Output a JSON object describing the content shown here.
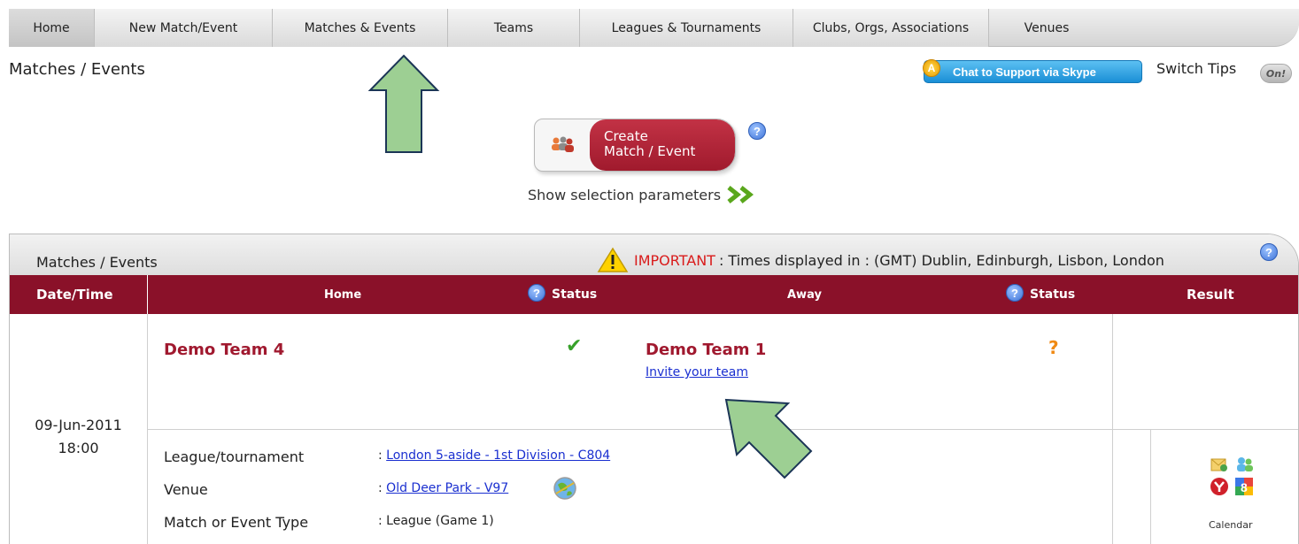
{
  "nav": {
    "items": [
      {
        "label": "Home"
      },
      {
        "label": "New Match/Event"
      },
      {
        "label": "Matches & Events"
      },
      {
        "label": "Teams"
      },
      {
        "label": "Leagues & Tournaments"
      },
      {
        "label": "Clubs, Orgs, Associations"
      },
      {
        "label": "Venues"
      }
    ]
  },
  "page": {
    "title": "Matches / Events",
    "skype_badge": "A",
    "skype_label": "Chat to Support via Skype",
    "switch_tips": "Switch Tips",
    "tips_state": "On!",
    "create_line1": "Create",
    "create_line2": "Match / Event",
    "show_params": "Show selection parameters"
  },
  "panel": {
    "title": "Matches / Events",
    "important_word": "IMPORTANT",
    "important_text": ": Times displayed in : (GMT) Dublin, Edinburgh, Lisbon, London",
    "columns": {
      "datetime": "Date/Time",
      "home": "Home",
      "home_status": "Status",
      "away": "Away",
      "away_status": "Status",
      "result": "Result"
    }
  },
  "match": {
    "date": "09-Jun-2011",
    "time": "18:00",
    "home_team": "Demo Team 4",
    "away_team": "Demo Team 1",
    "invite_link": "Invite your team",
    "details": [
      {
        "label": "League/tournament",
        "value": "London 5-aside - 1st Division - C804"
      },
      {
        "label": "Venue",
        "value": "Old Deer Park - V97"
      },
      {
        "label": "Match or Event Type",
        "value": "League (Game 1)"
      }
    ],
    "calendar_label": "Calendar"
  },
  "colors": {
    "header_bg": "#8a1129",
    "team_text": "#a0192f",
    "link": "#1a2fd0",
    "arrow_fill": "#9dcf93"
  }
}
